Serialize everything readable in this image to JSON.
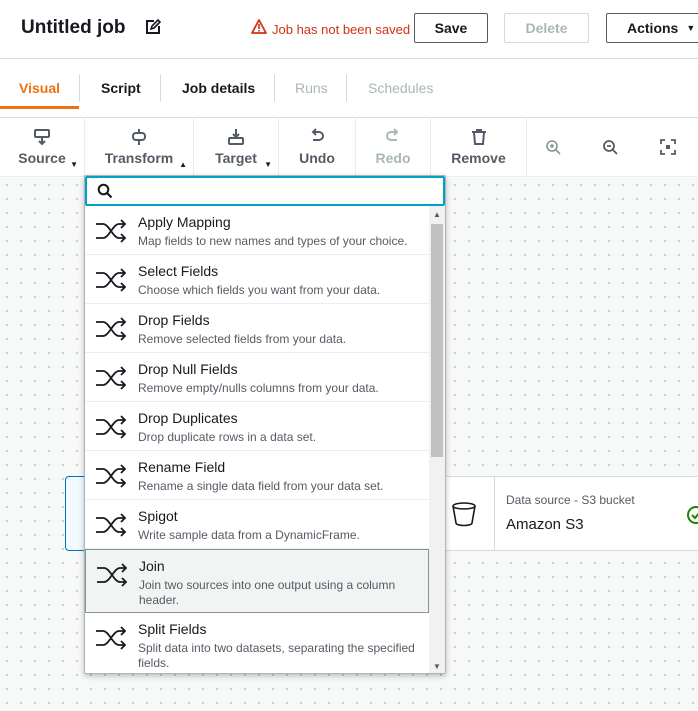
{
  "header": {
    "title": "Untitled job",
    "warning": "Job has not been saved",
    "save_label": "Save",
    "delete_label": "Delete",
    "actions_label": "Actions"
  },
  "tabs": [
    {
      "label": "Visual",
      "state": "active"
    },
    {
      "label": "Script",
      "state": "normal"
    },
    {
      "label": "Job details",
      "state": "normal"
    },
    {
      "label": "Runs",
      "state": "disabled"
    },
    {
      "label": "Schedules",
      "state": "disabled"
    }
  ],
  "toolbar": {
    "source": "Source",
    "transform": "Transform",
    "target": "Target",
    "undo": "Undo",
    "redo": "Redo",
    "remove": "Remove"
  },
  "search": {
    "value": "",
    "placeholder": ""
  },
  "transforms": [
    {
      "name": "Apply Mapping",
      "desc": "Map fields to new names and types of your choice."
    },
    {
      "name": "Select Fields",
      "desc": "Choose which fields you want from your data."
    },
    {
      "name": "Drop Fields",
      "desc": "Remove selected fields from your data."
    },
    {
      "name": "Drop Null Fields",
      "desc": "Remove empty/nulls columns from your data."
    },
    {
      "name": "Drop Duplicates",
      "desc": "Drop duplicate rows in a data set."
    },
    {
      "name": "Rename Field",
      "desc": "Rename a single data field from your data set."
    },
    {
      "name": "Spigot",
      "desc": "Write sample data from a DynamicFrame."
    },
    {
      "name": "Join",
      "desc": "Join two sources into one output using a column header."
    },
    {
      "name": "Split Fields",
      "desc": "Split data into two datasets, separating the specified fields."
    }
  ],
  "node": {
    "subtitle": "Data source - S3 bucket",
    "title": "Amazon S3"
  },
  "colors": {
    "accent": "#ec7211",
    "warning": "#d13212",
    "focus": "#00a1c9",
    "success": "#1d8102"
  }
}
